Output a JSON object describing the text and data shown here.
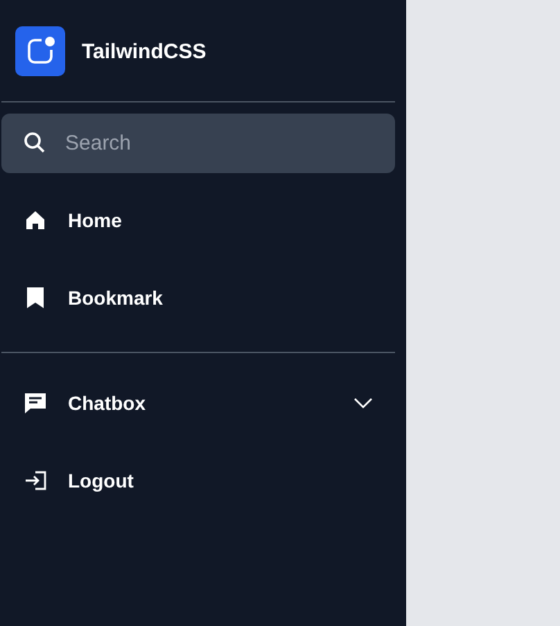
{
  "brand": {
    "name": "TailwindCSS"
  },
  "search": {
    "placeholder": "Search"
  },
  "sections": [
    {
      "items": [
        {
          "kind": "home",
          "label": "Home"
        },
        {
          "kind": "bookmark",
          "label": "Bookmark"
        }
      ]
    },
    {
      "items": [
        {
          "kind": "chat",
          "label": "Chatbox",
          "expanded": false
        },
        {
          "kind": "logout",
          "label": "Logout"
        }
      ]
    }
  ]
}
